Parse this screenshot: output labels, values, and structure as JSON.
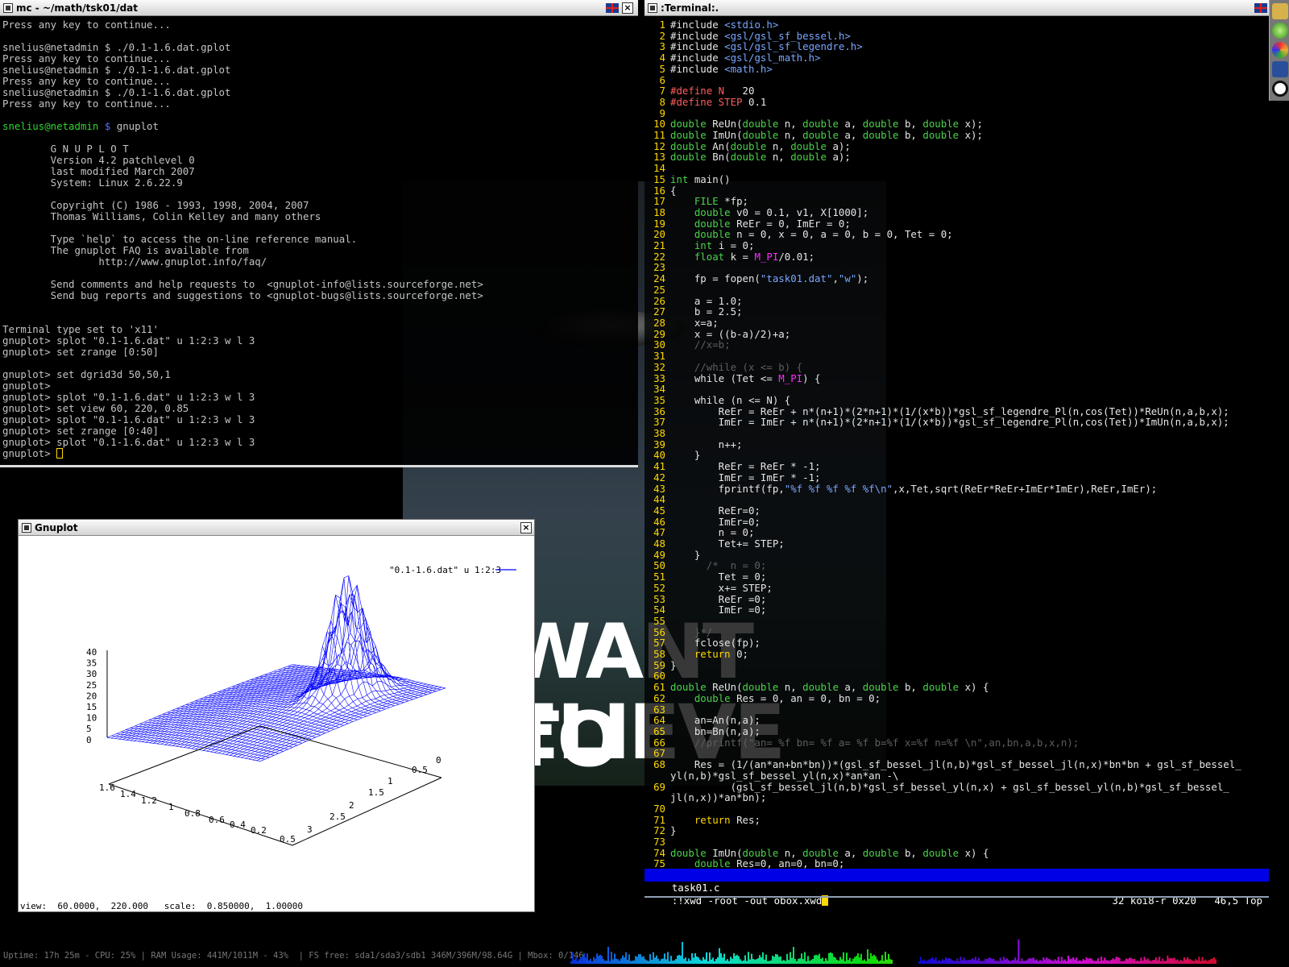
{
  "mc_window": {
    "title": "mc - ~/math/tsk01/dat",
    "lines": [
      "Press any key to continue...",
      "",
      "snelius@netadmin $ ./0.1-1.6.dat.gplot",
      "Press any key to continue...",
      "snelius@netadmin $ ./0.1-1.6.dat.gplot",
      "Press any key to continue...",
      "snelius@netadmin $ ./0.1-1.6.dat.gplot",
      "Press any key to continue...",
      ""
    ],
    "prompt_user": "snelius@netadmin",
    "prompt_sym": "$",
    "prompt_cmd": " gnuplot",
    "gnuplot_banner": [
      "",
      "        G N U P L O T",
      "        Version 4.2 patchlevel 0",
      "        last modified March 2007",
      "        System: Linux 2.6.22.9",
      "",
      "        Copyright (C) 1986 - 1993, 1998, 2004, 2007",
      "        Thomas Williams, Colin Kelley and many others",
      "",
      "        Type `help` to access the on-line reference manual.",
      "        The gnuplot FAQ is available from",
      "                http://www.gnuplot.info/faq/",
      "",
      "        Send comments and help requests to  <gnuplot-info@lists.sourceforge.net>",
      "        Send bug reports and suggestions to <gnuplot-bugs@lists.sourceforge.net>",
      "",
      "",
      "Terminal type set to 'x11'",
      "gnuplot> splot \"0.1-1.6.dat\" u 1:2:3 w l 3",
      "gnuplot> set zrange [0:50]",
      "",
      "gnuplot> set dgrid3d 50,50,1",
      "gnuplot>",
      "gnuplot> splot \"0.1-1.6.dat\" u 1:2:3 w l 3",
      "gnuplot> set view 60, 220, 0.85",
      "gnuplot> splot \"0.1-1.6.dat\" u 1:2:3 w l 3",
      "gnuplot> set zrange [0:40]",
      "gnuplot> splot \"0.1-1.6.dat\" u 1:2:3 w l 3"
    ],
    "last_prompt": "gnuplot> "
  },
  "terminal_window": {
    "title": ":Terminal:.",
    "code_lines": [
      "#include <stdio.h>",
      "#include <gsl/gsl_sf_bessel.h>",
      "#include <gsl/gsl_sf_legendre.h>",
      "#include <gsl/gsl_math.h>",
      "#include <math.h>",
      "",
      "#define N   20",
      "#define STEP 0.1",
      "",
      "double ReUn(double n, double a, double b, double x);",
      "double ImUn(double n, double a, double b, double x);",
      "double An(double n, double a);",
      "double Bn(double n, double a);",
      "",
      "int main()",
      "{",
      "    FILE *fp;",
      "    double v0 = 0.1, v1, X[1000];",
      "    double ReEr = 0, ImEr = 0;",
      "    double n = 0, x = 0, a = 0, b = 0, Tet = 0;",
      "    int i = 0;",
      "    float k = M_PI/0.01;",
      "",
      "    fp = fopen(\"task01.dat\",\"w\");",
      "",
      "    a = 1.0;",
      "    b = 2.5;",
      "    x=a;",
      "    x = ((b-a)/2)+a;",
      "    //x=b;",
      "",
      "    //while (x <= b) {",
      "    while (Tet <= M_PI) {",
      "",
      "    while (n <= N) {",
      "        ReEr = ReEr + n*(n+1)*(2*n+1)*(1/(x*b))*gsl_sf_legendre_Pl(n,cos(Tet))*ReUn(n,a,b,x);",
      "        ImEr = ImEr + n*(n+1)*(2*n+1)*(1/(x*b))*gsl_sf_legendre_Pl(n,cos(Tet))*ImUn(n,a,b,x);",
      "",
      "        n++;",
      "    }",
      "        ReEr = ReEr * -1;",
      "        ImEr = ImEr * -1;",
      "        fprintf(fp,\"%f %f %f %f %f\\n\",x,Tet,sqrt(ReEr*ReEr+ImEr*ImEr),ReEr,ImEr);",
      "",
      "        ReEr=0;",
      "        ImEr=0;",
      "        n = 0;",
      "        Tet+= STEP;",
      "    }",
      "      /*  n = 0;",
      "        Tet = 0;",
      "        x+= STEP;",
      "        ReEr =0;",
      "        ImEr =0;",
      "",
      "    }*/",
      "    fclose(fp);",
      "    return 0;",
      "}",
      "",
      "double ReUn(double n, double a, double b, double x) {",
      "    double Res = 0, an = 0, bn = 0;",
      "",
      "    an=An(n,a);",
      "    bn=Bn(n,a);",
      "    //printf(\"an= %f bn= %f a= %f b=%f x=%f n=%f \\n\",an,bn,a,b,x,n);",
      "",
      "    Res = (1/(an*an+bn*bn))*(gsl_sf_bessel_jl(n,b)*gsl_sf_bessel_jl(n,x)*bn*bn + gsl_sf_bessel_",
      "yl(n,b)*gsl_sf_bessel_yl(n,x)*an*an -\\",
      "          (gsl_sf_bessel_jl(n,b)*gsl_sf_bessel_yl(n,x) + gsl_sf_bessel_yl(n,b)*gsl_sf_bessel_",
      "jl(n,x))*an*bn);",
      "",
      "    return Res;",
      "}",
      "",
      "double ImUn(double n, double a, double b, double x) {",
      "    double Res=0, an=0, bn=0;"
    ],
    "line_numbers": [
      "1",
      "2",
      "3",
      "4",
      "5",
      "6",
      "7",
      "8",
      "9",
      "10",
      "11",
      "12",
      "13",
      "14",
      "15",
      "16",
      "17",
      "18",
      "19",
      "20",
      "21",
      "22",
      "23",
      "24",
      "25",
      "26",
      "27",
      "28",
      "29",
      "30",
      "31",
      "32",
      "33",
      "34",
      "35",
      "36",
      "37",
      "38",
      "39",
      "40",
      "41",
      "42",
      "43",
      "44",
      "45",
      "46",
      "47",
      "48",
      "49",
      "50",
      "51",
      "52",
      "53",
      "54",
      "55",
      "56",
      "57",
      "58",
      "59",
      "60",
      "61",
      "62",
      "63",
      "64",
      "65",
      "66",
      "67",
      "68",
      "",
      "69",
      "",
      "70",
      "71",
      "72",
      "73",
      "74",
      "75"
    ],
    "status_left": "task01.c",
    "status_right": "32 koi8-r 0x20   46,5 Top",
    "command": ":!xwd -root -out obox.xwd"
  },
  "gnuplot_window": {
    "title": "Gnuplot",
    "legend": "\"0.1-1.6.dat\" u 1:2:3",
    "z_ticks": [
      "40",
      "35",
      "30",
      "25",
      "20",
      "15",
      "10",
      "5",
      "0"
    ],
    "x_ticks": [
      "1.6",
      "1.4",
      "1.2",
      "1",
      "0.8",
      "0.6",
      "0.4",
      "0.2",
      "0.5"
    ],
    "y_ticks": [
      "3",
      "2.5",
      "2",
      "1.5",
      "1",
      "0.5",
      "0"
    ],
    "footer": "view:  60.0000,  220.000   scale:  0.850000,  1.00000",
    "view": {
      "rot_x": 60,
      "rot_z": 220,
      "scale": 0.85,
      "scale_z": 1.0
    },
    "zrange": [
      0,
      40
    ],
    "dgrid": [
      50,
      50
    ]
  },
  "wallpaper": {
    "line1": "WANT TO",
    "line2": "ELIEVE"
  },
  "conky": {
    "text": "Uptime: 17h 25m - CPU: 25% | RAM Usage: 441M/1011M - 43%  | FS free: sda1/sda3/sdb1 346M/396M/98.64G | Mbox: 0/146"
  },
  "colors": {
    "prompt_green": "#2fd72f",
    "line_number": "#ffd800",
    "status_bar": "#0000e6",
    "plot_line": "#0000ff"
  }
}
